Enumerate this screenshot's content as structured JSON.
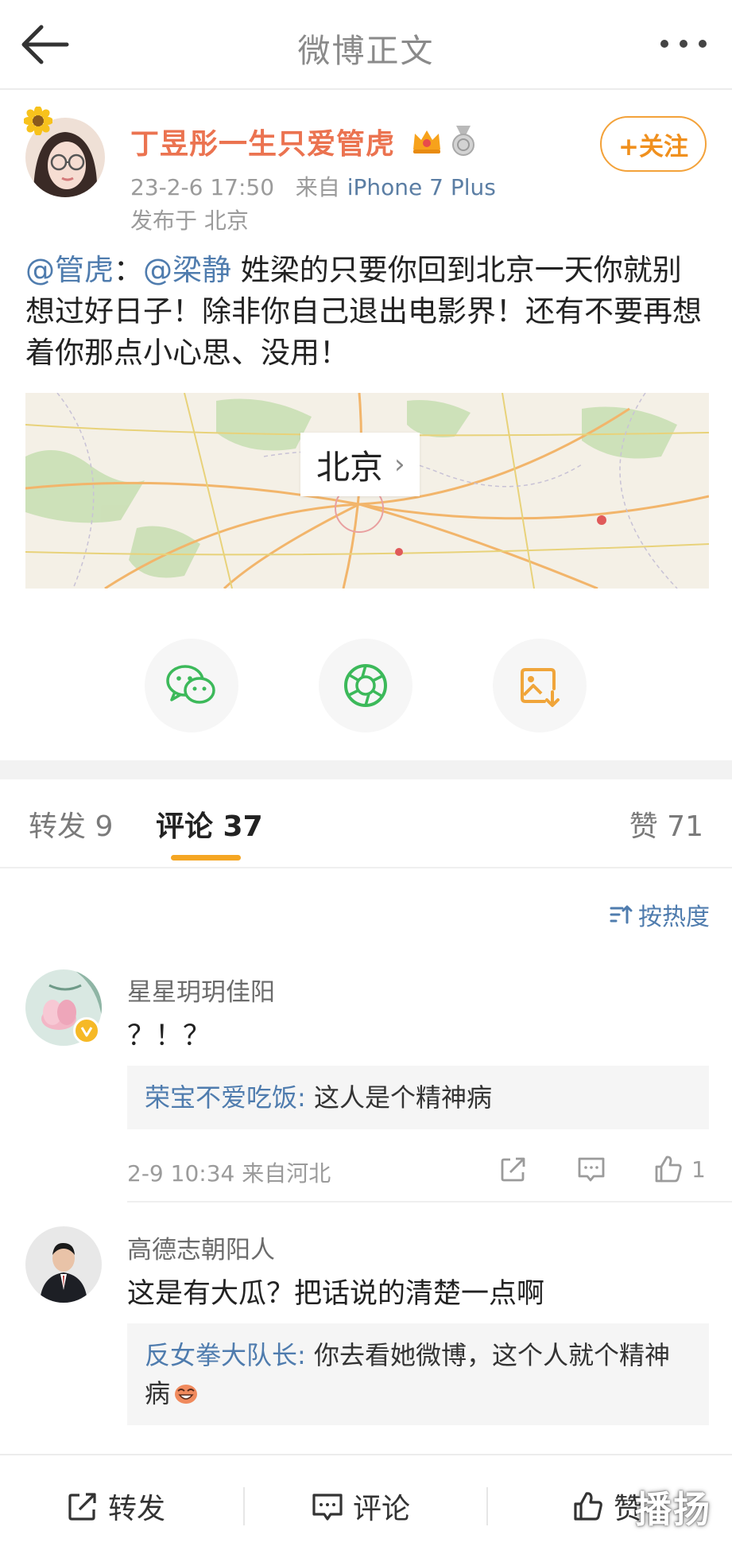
{
  "topbar": {
    "title": "微博正文"
  },
  "post": {
    "author": "丁昱彤一生只爱管虎",
    "time": "23-2-6 17:50",
    "from_prefix": "来自",
    "source": "iPhone 7 Plus",
    "location": "发布于 北京",
    "follow_label": "+关注",
    "body": {
      "mention1": "@管虎",
      "sep": "：",
      "mention2": "@梁静",
      "text": " 姓梁的只要你回到北京一天你就别想过好日子！除非你自己退出电影界！还有不要再想着你那点小心思、没用！"
    },
    "map_label": "北京"
  },
  "tabs": {
    "repost": "转发 9",
    "comments": "评论 37",
    "likes": "赞 71"
  },
  "sort_label": "按热度",
  "comments": [
    {
      "name": "星星玥玥佳阳",
      "text": "？！？",
      "reply_name": "荣宝不爱吃饭:",
      "reply_text": " 这人是个精神病",
      "meta": "2-9 10:34  来自河北",
      "like_count": "1"
    },
    {
      "name": "高德志朝阳人",
      "text": "这是有大瓜？把话说的清楚一点啊",
      "reply_name": "反女拳大队长:",
      "reply_text": " 你去看她微博，这个人就个精神病"
    }
  ],
  "bottombar": {
    "repost": "转发",
    "comment": "评论",
    "like": "赞"
  },
  "watermark": "播扬",
  "colors": {
    "accent_orange": "#f5a623",
    "username_orange": "#eb7350",
    "link_blue": "#4f7cae",
    "wechat_green": "#3cb95a"
  }
}
